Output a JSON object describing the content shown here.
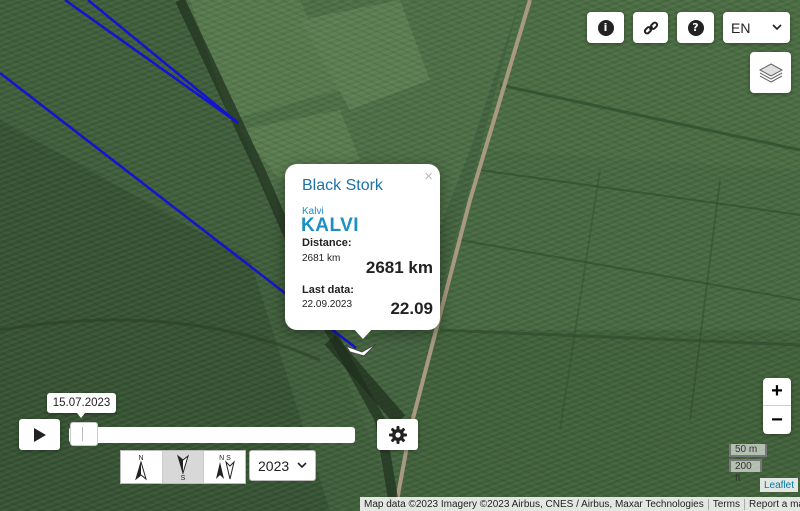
{
  "toolbar": {
    "info_icon": "info-icon",
    "link_icon": "link-icon",
    "help_icon": "help-icon",
    "language": "EN",
    "layers_icon": "layers-icon"
  },
  "popup": {
    "species": "Black Stork",
    "close": "×",
    "location": "Kalvi",
    "bird_name": "KALVI",
    "distance_label": "Distance:",
    "distance_small": "2681 km",
    "distance_big": "2681 km",
    "lastdata_label": "Last data:",
    "lastdata_small": "22.09.2023",
    "lastdata_big": "22.09"
  },
  "timeline": {
    "date": "15.07.2023",
    "year": "2023",
    "play_icon": "play-icon",
    "settings_icon": "gear-icon"
  },
  "direction_buttons": [
    {
      "icon": "north-arrow-icon",
      "letter": "N"
    },
    {
      "icon": "south-arrow-icon",
      "letter": "S"
    },
    {
      "icon": "north-south-arrow-icon",
      "letters": "N S"
    }
  ],
  "zoom": {
    "in": "+",
    "out": "−"
  },
  "scale": {
    "metric": "50 m",
    "imperial": "200 ft"
  },
  "attribution": {
    "map_data": "Map data ©2023 Imagery ©2023 Airbus, CNES / Airbus, Maxar Technologies",
    "terms": "Terms",
    "report": "Report a map error",
    "leaflet": "Leaflet"
  },
  "colors": {
    "track": "#1010c8",
    "accent": "#1d8fc4",
    "title": "#1d72a8"
  }
}
